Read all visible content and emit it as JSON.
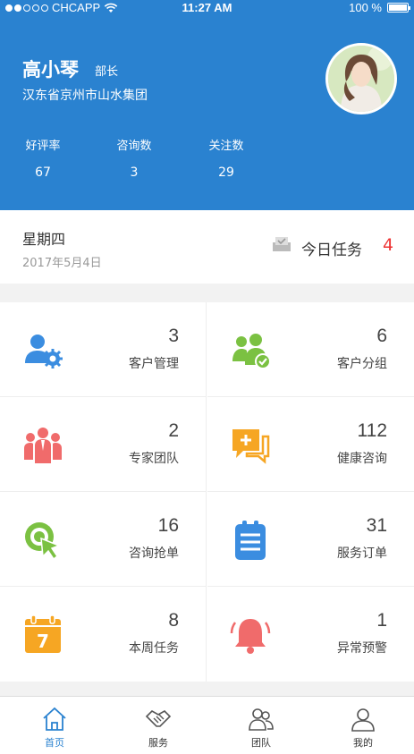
{
  "status_bar": {
    "carrier": "CHCAPP",
    "time": "11:27 AM",
    "battery": "100 %",
    "battery_level": 1.0
  },
  "profile": {
    "name": "高小琴",
    "title": "部长",
    "org": "汉东省京州市山水集团"
  },
  "stats": [
    {
      "label": "好评率",
      "value": "67"
    },
    {
      "label": "咨询数",
      "value": "3"
    },
    {
      "label": "关注数",
      "value": "29"
    }
  ],
  "today": {
    "weekday": "星期四",
    "date": "2017年5月4日",
    "task_label": "今日任务",
    "task_count": "4"
  },
  "grid": [
    {
      "label": "客户管理",
      "count": "3",
      "icon": "user-gear-icon",
      "color": "#3b8de0"
    },
    {
      "label": "客户分组",
      "count": "6",
      "icon": "group-check-icon",
      "color": "#7bc142"
    },
    {
      "label": "专家团队",
      "count": "2",
      "icon": "team-icon",
      "color": "#f06b6b"
    },
    {
      "label": "健康咨询",
      "count": "112",
      "icon": "chat-plus-icon",
      "color": "#f6a623"
    },
    {
      "label": "咨询抢单",
      "count": "16",
      "icon": "target-cursor-icon",
      "color": "#7bc142"
    },
    {
      "label": "服务订单",
      "count": "31",
      "icon": "clipboard-list-icon",
      "color": "#3b8de0"
    },
    {
      "label": "本周任务",
      "count": "8",
      "icon": "calendar-icon",
      "color": "#f6a623"
    },
    {
      "label": "异常预警",
      "count": "1",
      "icon": "bell-icon",
      "color": "#f06b6b"
    }
  ],
  "tabs": [
    {
      "label": "首页",
      "icon": "home-icon",
      "active": true
    },
    {
      "label": "服务",
      "icon": "handshake-icon",
      "active": false
    },
    {
      "label": "团队",
      "icon": "team-outline-icon",
      "active": false
    },
    {
      "label": "我的",
      "icon": "person-icon",
      "active": false
    }
  ],
  "colors": {
    "primary": "#2a82d0",
    "alert": "#e33333"
  }
}
